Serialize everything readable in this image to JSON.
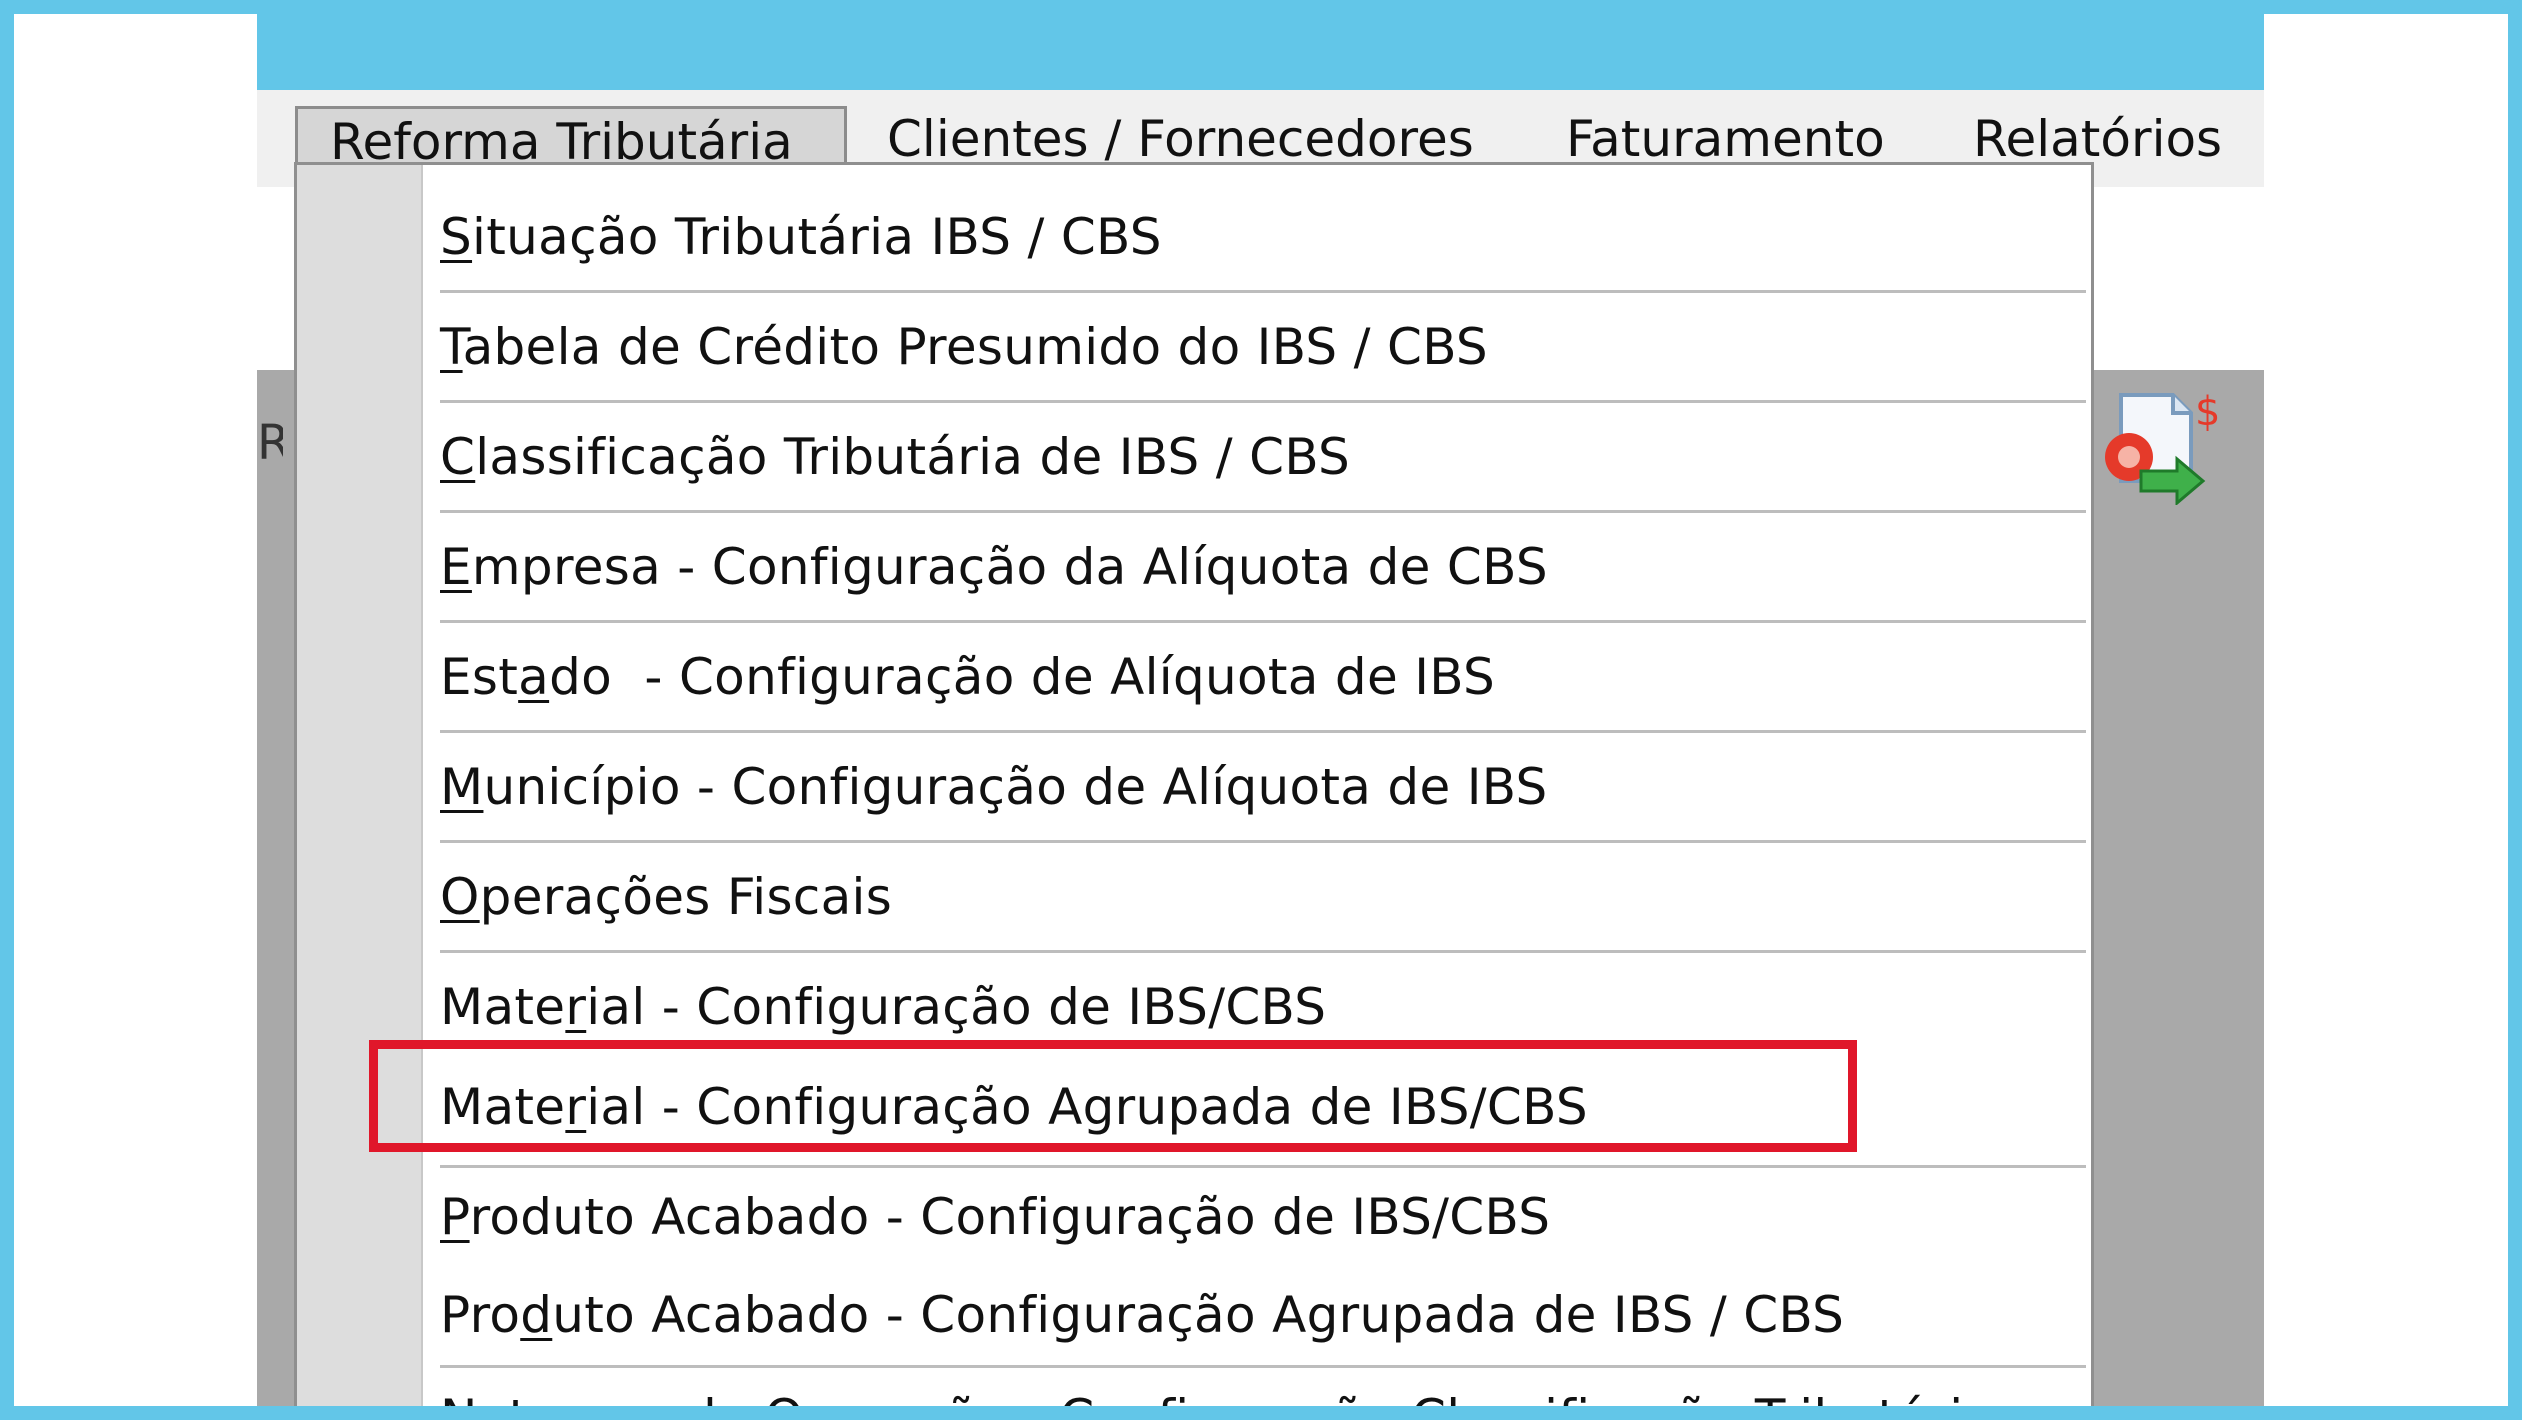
{
  "menubar": {
    "items": [
      {
        "label": "Reforma Tributária",
        "mnemonic": "R",
        "rest": "eforma Tributária"
      },
      {
        "label": "Clientes / Fornecedores",
        "mnemonic": "C",
        "rest": "lientes / Fornecedores"
      },
      {
        "label": "Faturamento",
        "mnemonic": "F",
        "rest": "aturamento"
      },
      {
        "label": "Relatórios",
        "pre": "Re",
        "mnemonic": "l",
        "rest": "atórios"
      }
    ]
  },
  "toolbar": {
    "clipped_left_label": "R",
    "report_icon_symbol": "$"
  },
  "dropdown": {
    "items": [
      {
        "pre": "",
        "mnemonic": "S",
        "rest": "ituação Tributária IBS / CBS"
      },
      {
        "pre": "",
        "mnemonic": "T",
        "rest": "abela de Crédito Presumido do IBS / CBS"
      },
      {
        "pre": "",
        "mnemonic": "C",
        "rest": "lassificação Tributária de IBS / CBS"
      },
      {
        "pre": "",
        "mnemonic": "E",
        "rest": "mpresa - Configuração da Alíquota de CBS"
      },
      {
        "pre": "Est",
        "mnemonic": "a",
        "rest": "do  - Configuração de Alíquota de IBS"
      },
      {
        "pre": "",
        "mnemonic": "M",
        "rest": "unicípio - Configuração de Alíquota de IBS"
      },
      {
        "pre": "",
        "mnemonic": "O",
        "rest": "perações Fiscais"
      },
      {
        "pre": "Mate",
        "mnemonic": "r",
        "rest": "ial - Configuração de IBS/CBS"
      },
      {
        "pre": "Mate",
        "mnemonic": "r",
        "rest": "ial - Configuração Agrupada de IBS/CBS"
      },
      {
        "pre": "",
        "mnemonic": "P",
        "rest": "roduto Acabado - Configuração de IBS/CBS"
      },
      {
        "pre": "Pro",
        "mnemonic": "d",
        "rest": "uto Acabado - Configuração Agrupada de IBS / CBS"
      },
      {
        "pre": "",
        "mnemonic": "N",
        "rest": "atureza de Operação - Configuração Classificação Tributária"
      }
    ]
  },
  "colors": {
    "background_frame": "#62c6e8",
    "highlight_box": "#e0172a",
    "menu_active_bg": "#d6d6d6",
    "gutter": "#dddddd"
  }
}
